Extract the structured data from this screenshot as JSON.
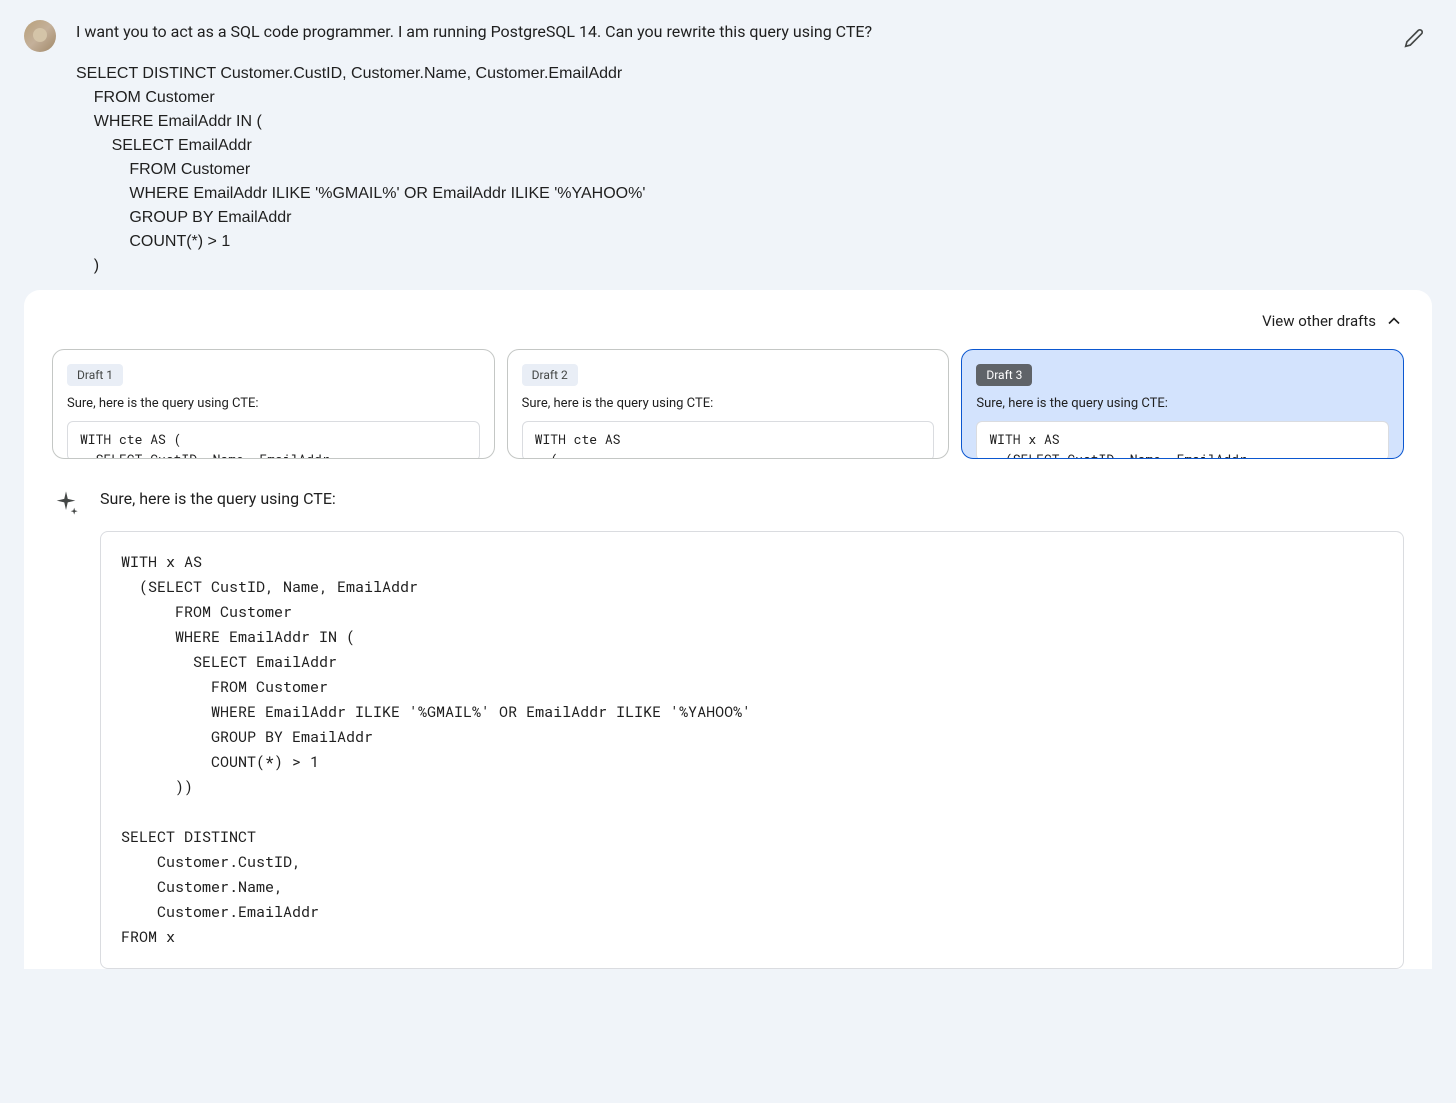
{
  "user_message": {
    "intro": "I want you to act as a SQL code programmer. I am running PostgreSQL 14. Can you rewrite this query using CTE?",
    "query": "SELECT DISTINCT Customer.CustID, Customer.Name, Customer.EmailAddr\n    FROM Customer\n    WHERE EmailAddr IN (\n        SELECT EmailAddr\n            FROM Customer\n            WHERE EmailAddr ILIKE '%GMAIL%' OR EmailAddr ILIKE '%YAHOO%'\n            GROUP BY EmailAddr\n            COUNT(*) > 1\n    )"
  },
  "drafts": {
    "header_label": "View other drafts",
    "cards": [
      {
        "badge": "Draft 1",
        "preview_text": "Sure, here is the query using CTE:",
        "code_preview": "WITH cte AS (\n  SELECT CustID, Name, EmailAddr",
        "selected": false
      },
      {
        "badge": "Draft 2",
        "preview_text": "Sure, here is the query using CTE:",
        "code_preview": "WITH cte AS\n  (",
        "selected": false
      },
      {
        "badge": "Draft 3",
        "preview_text": "Sure, here is the query using CTE:",
        "code_preview": "WITH x AS\n  (SELECT CustID, Name, EmailAddr",
        "selected": true
      }
    ]
  },
  "response": {
    "intro": "Sure, here is the query using CTE:",
    "code": "WITH x AS\n  (SELECT CustID, Name, EmailAddr\n      FROM Customer\n      WHERE EmailAddr IN (\n        SELECT EmailAddr\n          FROM Customer\n          WHERE EmailAddr ILIKE '%GMAIL%' OR EmailAddr ILIKE '%YAHOO%'\n          GROUP BY EmailAddr\n          COUNT(*) > 1\n      ))\n\nSELECT DISTINCT\n    Customer.CustID,\n    Customer.Name,\n    Customer.EmailAddr\nFROM x"
  }
}
